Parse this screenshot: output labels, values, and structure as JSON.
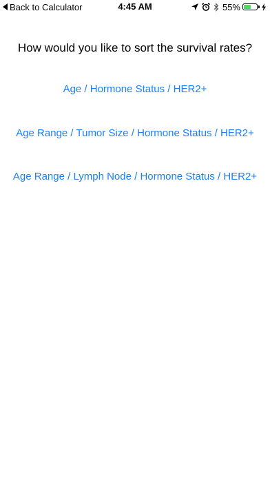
{
  "status_bar": {
    "back_label": "Back to Calculator",
    "time": "4:45 AM",
    "battery_percent": "55%",
    "battery_level": 0.55,
    "icons": [
      "location-arrow-icon",
      "alarm-icon",
      "bluetooth-icon",
      "battery-icon",
      "charging-bolt-icon"
    ]
  },
  "main": {
    "prompt": "How would you like to sort the survival rates?",
    "options": [
      {
        "label": "Age / Hormone Status / HER2+"
      },
      {
        "label": "Age Range / Tumor Size / Hormone Status / HER2+"
      },
      {
        "label": "Age Range / Lymph Node / Hormone Status / HER2+"
      }
    ]
  },
  "colors": {
    "link": "#1a7ff5",
    "text": "#000000",
    "background": "#ffffff",
    "battery_fill": "#4cd964"
  }
}
